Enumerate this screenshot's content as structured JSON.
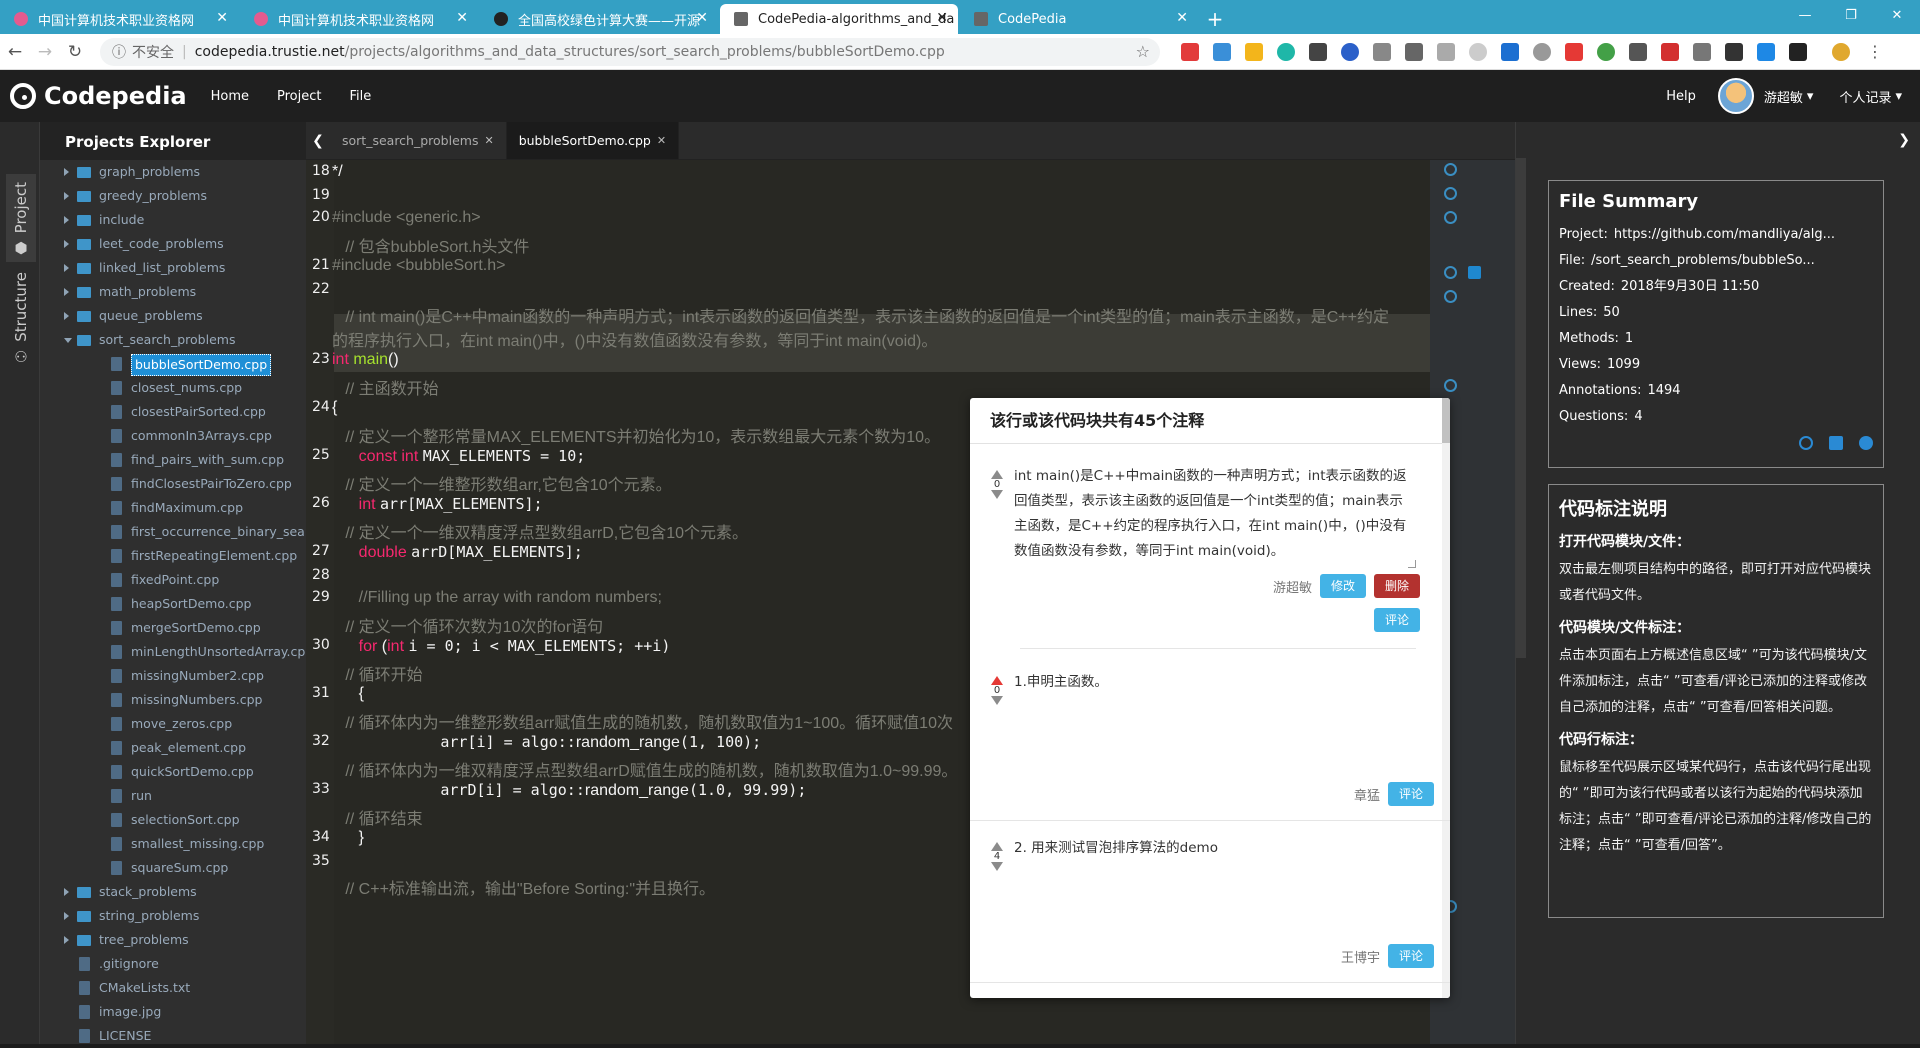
{
  "browser": {
    "tabs": [
      {
        "title": "中国计算机技术职业资格网"
      },
      {
        "title": "中国计算机技术职业资格网"
      },
      {
        "title": "全国高校绿色计算大赛——开源"
      },
      {
        "title": "CodePedia-algorithms_and_da"
      },
      {
        "title": "CodePedia"
      }
    ],
    "security": "不安全",
    "url_host": "codepedia.trustie.net",
    "url_path": "/projects/algorithms_and_data_structures/sort_search_problems/bubbleSortDemo.cpp"
  },
  "app": {
    "brand": "Codepedia",
    "nav": [
      "Home",
      "Project",
      "File"
    ],
    "help": "Help",
    "user": "游超敏",
    "records": "个人记录"
  },
  "activity": {
    "project": "Project",
    "structure": "Structure"
  },
  "explorer": {
    "title": "Projects Explorer",
    "items": [
      {
        "label": "graph_problems",
        "kind": "folder",
        "level": 0
      },
      {
        "label": "greedy_problems",
        "kind": "folder",
        "level": 0
      },
      {
        "label": "include",
        "kind": "folder",
        "level": 0
      },
      {
        "label": "leet_code_problems",
        "kind": "folder",
        "level": 0
      },
      {
        "label": "linked_list_problems",
        "kind": "folder",
        "level": 0
      },
      {
        "label": "math_problems",
        "kind": "folder",
        "level": 0
      },
      {
        "label": "queue_problems",
        "kind": "folder",
        "level": 0
      },
      {
        "label": "sort_search_problems",
        "kind": "folder",
        "level": 0,
        "open": true
      },
      {
        "label": "bubbleSortDemo.cpp",
        "kind": "file",
        "level": 1,
        "selected": true
      },
      {
        "label": "closest_nums.cpp",
        "kind": "file",
        "level": 1
      },
      {
        "label": "closestPairSorted.cpp",
        "kind": "file",
        "level": 1
      },
      {
        "label": "commonIn3Arrays.cpp",
        "kind": "file",
        "level": 1
      },
      {
        "label": "find_pairs_with_sum.cpp",
        "kind": "file",
        "level": 1
      },
      {
        "label": "findClosestPairToZero.cpp",
        "kind": "file",
        "level": 1
      },
      {
        "label": "findMaximum.cpp",
        "kind": "file",
        "level": 1
      },
      {
        "label": "first_occurrence_binary_search",
        "kind": "file",
        "level": 1
      },
      {
        "label": "firstRepeatingElement.cpp",
        "kind": "file",
        "level": 1
      },
      {
        "label": "fixedPoint.cpp",
        "kind": "file",
        "level": 1
      },
      {
        "label": "heapSortDemo.cpp",
        "kind": "file",
        "level": 1
      },
      {
        "label": "mergeSortDemo.cpp",
        "kind": "file",
        "level": 1
      },
      {
        "label": "minLengthUnsortedArray.cpp",
        "kind": "file",
        "level": 1
      },
      {
        "label": "missingNumber2.cpp",
        "kind": "file",
        "level": 1
      },
      {
        "label": "missingNumbers.cpp",
        "kind": "file",
        "level": 1
      },
      {
        "label": "move_zeros.cpp",
        "kind": "file",
        "level": 1
      },
      {
        "label": "peak_element.cpp",
        "kind": "file",
        "level": 1
      },
      {
        "label": "quickSortDemo.cpp",
        "kind": "file",
        "level": 1
      },
      {
        "label": "run",
        "kind": "file",
        "level": 1
      },
      {
        "label": "selectionSort.cpp",
        "kind": "file",
        "level": 1
      },
      {
        "label": "smallest_missing.cpp",
        "kind": "file",
        "level": 1
      },
      {
        "label": "squareSum.cpp",
        "kind": "file",
        "level": 1
      },
      {
        "label": "stack_problems",
        "kind": "folder",
        "level": 0
      },
      {
        "label": "string_problems",
        "kind": "folder",
        "level": 0
      },
      {
        "label": "tree_problems",
        "kind": "folder",
        "level": 0
      },
      {
        "label": ".gitignore",
        "kind": "file",
        "level": 0
      },
      {
        "label": "CMakeLists.txt",
        "kind": "file",
        "level": 0
      },
      {
        "label": "image.jpg",
        "kind": "file",
        "level": 0
      },
      {
        "label": "LICENSE",
        "kind": "file",
        "level": 0
      }
    ]
  },
  "editor": {
    "tabs": [
      {
        "label": "sort_search_problems",
        "active": false
      },
      {
        "label": "bubbleSortDemo.cpp",
        "active": true
      }
    ],
    "lines": [
      {
        "n": "18",
        "parts": [
          {
            "t": "*/",
            "c": "c-white"
          }
        ]
      },
      {
        "n": "19",
        "parts": []
      },
      {
        "n": "20",
        "parts": [
          {
            "t": "#include <generic.h>",
            "c": "c-comment"
          }
        ]
      },
      {
        "n": "",
        "parts": [
          {
            "t": "   // 包含bubbleSort.h头文件",
            "c": "c-comment"
          }
        ]
      },
      {
        "n": "21",
        "parts": [
          {
            "t": "#include <bubbleSort.h>",
            "c": "c-comment"
          }
        ]
      },
      {
        "n": "22",
        "parts": []
      },
      {
        "n": "",
        "parts": [
          {
            "t": "   // int main()是C++中main函数的一种声明方式；int表示函数的返回值类型，表示该主函数的返回值是一个int类型的值；main表示主函数，是C++约定",
            "c": "c-comment"
          }
        ]
      },
      {
        "n": "",
        "parts": [
          {
            "t": "的程序执行入口，在int main()中，()中没有数值函数没有参数，等同于int main(void)。",
            "c": "c-comment"
          }
        ]
      },
      {
        "n": "23",
        "parts": [
          {
            "t": "int ",
            "c": "c-key"
          },
          {
            "t": "main",
            "c": "c-fn"
          },
          {
            "t": "()",
            "c": "c-white"
          }
        ]
      },
      {
        "n": "",
        "parts": [
          {
            "t": "   // 主函数开始",
            "c": "c-comment"
          }
        ]
      },
      {
        "n": "24",
        "parts": [
          {
            "t": "{",
            "c": "c-white"
          }
        ]
      },
      {
        "n": "",
        "parts": [
          {
            "t": "   // 定义一个整形常量MAX_ELEMENTS并初始化为10，表示数组最大元素个数为10。",
            "c": "c-comment"
          }
        ]
      },
      {
        "n": "25",
        "parts": [
          {
            "t": "      const int ",
            "c": "c-key"
          },
          {
            "t": "MAX_ELEMENTS = 10;",
            "c": "c-white mono"
          }
        ]
      },
      {
        "n": "",
        "parts": [
          {
            "t": "   // 定义一个一维整形数组arr,它包含10个元素。",
            "c": "c-comment"
          }
        ]
      },
      {
        "n": "26",
        "parts": [
          {
            "t": "      int ",
            "c": "c-key"
          },
          {
            "t": "arr[MAX_ELEMENTS];",
            "c": "c-white mono"
          }
        ]
      },
      {
        "n": "",
        "parts": [
          {
            "t": "   // 定义一个一维双精度浮点型数组arrD,它包含10个元素。",
            "c": "c-comment"
          }
        ]
      },
      {
        "n": "27",
        "parts": [
          {
            "t": "      double ",
            "c": "c-key"
          },
          {
            "t": "arrD[MAX_ELEMENTS];",
            "c": "c-white mono"
          }
        ]
      },
      {
        "n": "28",
        "parts": []
      },
      {
        "n": "29",
        "parts": [
          {
            "t": "      //Filling up the array with random numbers;",
            "c": "c-comment"
          }
        ]
      },
      {
        "n": "",
        "parts": [
          {
            "t": "   // 定义一个循环次数为10次的for语句",
            "c": "c-comment"
          }
        ]
      },
      {
        "n": "30",
        "parts": [
          {
            "t": "      for ",
            "c": "c-key"
          },
          {
            "t": "(",
            "c": "c-white"
          },
          {
            "t": "int ",
            "c": "c-key"
          },
          {
            "t": "i = 0; i < MAX_ELEMENTS; ++i)",
            "c": "c-white mono"
          }
        ]
      },
      {
        "n": "",
        "parts": [
          {
            "t": "   // 循环开始",
            "c": "c-comment"
          }
        ]
      },
      {
        "n": "31",
        "parts": [
          {
            "t": "      {",
            "c": "c-white"
          }
        ]
      },
      {
        "n": "",
        "parts": [
          {
            "t": "   // 循环体内为一维整形数组arr赋值生成的随机数，随机数取值为1~100。循环赋值10次",
            "c": "c-comment"
          }
        ]
      },
      {
        "n": "32",
        "parts": [
          {
            "t": "            arr[i] = algo::",
            "c": "c-white mono"
          },
          {
            "t": "random_range",
            "c": "c-white"
          },
          {
            "t": "(1, 100);",
            "c": "c-white mono"
          }
        ]
      },
      {
        "n": "",
        "parts": [
          {
            "t": "   // 循环体内为一维双精度浮点型数组arrD赋值生成的随机数，随机数取值为1.0~99.99。",
            "c": "c-comment"
          }
        ]
      },
      {
        "n": "33",
        "parts": [
          {
            "t": "            arrD[i] = algo::",
            "c": "c-white mono"
          },
          {
            "t": "random_range",
            "c": "c-white"
          },
          {
            "t": "(1.0, 99.99);",
            "c": "c-white mono"
          }
        ]
      },
      {
        "n": "",
        "parts": [
          {
            "t": "   // 循环结束",
            "c": "c-comment"
          }
        ]
      },
      {
        "n": "34",
        "parts": [
          {
            "t": "      }",
            "c": "c-white"
          }
        ]
      },
      {
        "n": "35",
        "parts": []
      },
      {
        "n": "",
        "parts": [
          {
            "t": "   // C++标准输出流，输出\"Before Sorting:\"并且换行。",
            "c": "c-comment"
          }
        ]
      }
    ]
  },
  "popup": {
    "title": "该行或该代码块共有45个注释",
    "notes": [
      {
        "votes": "0",
        "text": "int main()是C++中main函数的一种声明方式；int表示函数的返回值类型，表示该主函数的返回值是一个int类型的值；main表示主函数，是C++约定的程序执行入口，在int main()中，()中没有数值函数没有参数，等同于int main(void)。",
        "author": "游超敏",
        "edit": "修改",
        "delete": "删除",
        "comment": "评论"
      },
      {
        "votes": "0",
        "text": "1.申明主函数。",
        "author": "章猛",
        "comment": "评论"
      },
      {
        "votes": "4",
        "text": "2. 用来测试冒泡排序算法的demo",
        "author": "王博宇",
        "comment": "评论"
      }
    ]
  },
  "summary": {
    "title": "File Summary",
    "rows": [
      {
        "k": "Project:",
        "v": "https://github.com/mandliya/alg..."
      },
      {
        "k": "File:",
        "v": "/sort_search_problems/bubbleSo..."
      },
      {
        "k": "Created:",
        "v": "2018年9月30日 11:50"
      },
      {
        "k": "Lines:",
        "v": "50"
      },
      {
        "k": "Methods:",
        "v": "1"
      },
      {
        "k": "Views:",
        "v": "1099"
      },
      {
        "k": "Annotations:",
        "v": "1494"
      },
      {
        "k": "Questions:",
        "v": "4"
      }
    ]
  },
  "guide": {
    "title": "代码标注说明",
    "sections": [
      {
        "h": "打开代码模块/文件：",
        "p": "双击最左侧项目结构中的路径，即可打开对应代码模块或者代码文件。"
      },
      {
        "h": "代码模块/文件标注：",
        "p": "点击本页面右上方概述信息区域“ ”可为该代码模块/文件添加标注，点击“ ”可查看/评论已添加的注释或修改自己添加的注释，点击“ ”可查看/回答相关问题。"
      },
      {
        "h": "代码行标注：",
        "p": "鼠标移至代码展示区域某代码行，点击该代码行尾出现的“ ”即可为该行代码或者以该行为起始的代码块添加标注；点击“ ”即可查看/评论已添加的注释/修改自己的注释；点击“ ”可查看/回答”。"
      }
    ]
  },
  "colors": {
    "accent": "#34a0c4",
    "link_blue": "#43b3e6",
    "delete_red": "#b3322f"
  }
}
